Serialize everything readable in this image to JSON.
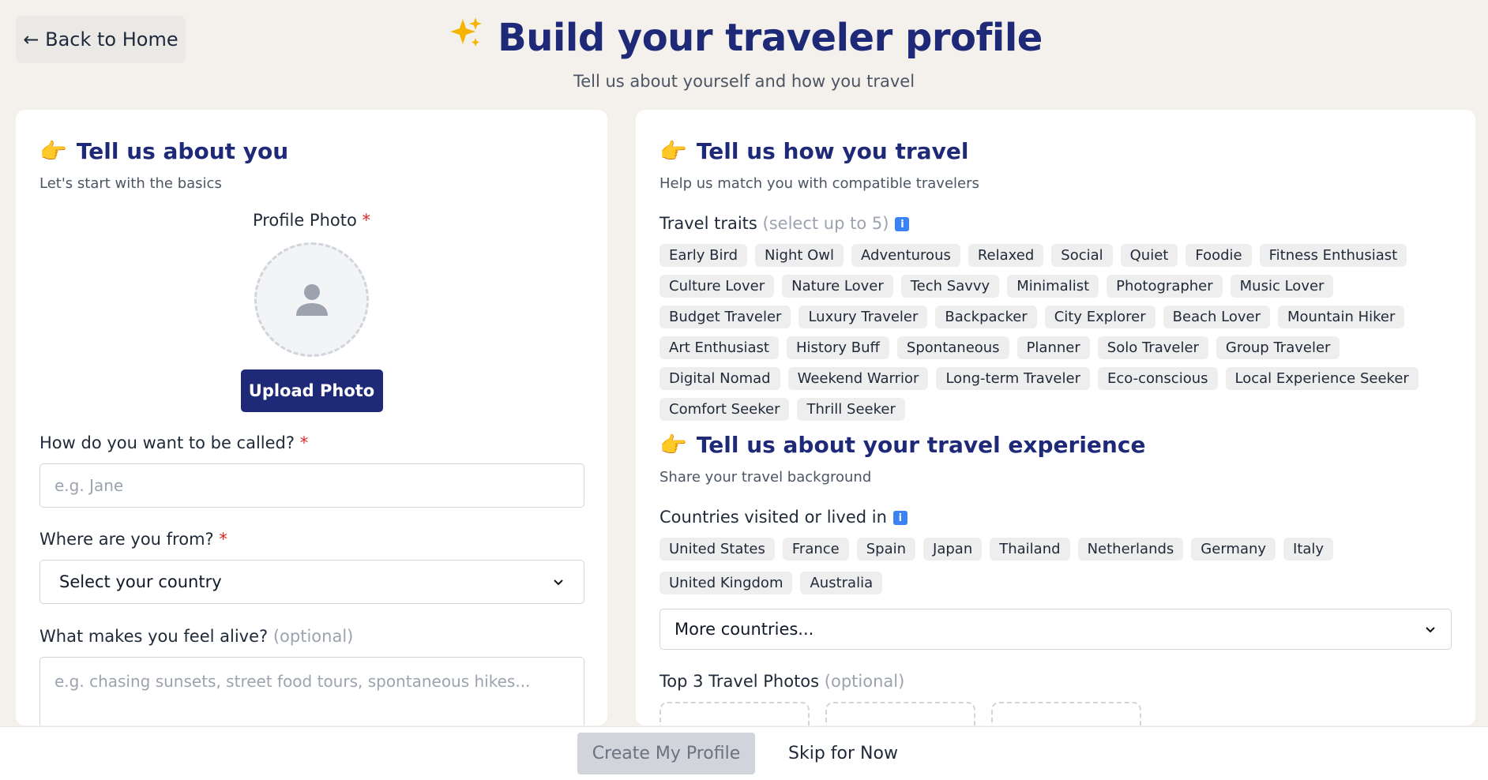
{
  "nav": {
    "back_label": "← Back to Home"
  },
  "header": {
    "title_icon": "sparkles-icon",
    "title": "Build your traveler profile",
    "subtitle": "Tell us about yourself and how you travel"
  },
  "about_you": {
    "title": "Tell us about you",
    "subtitle": "Let's start with the basics",
    "photo_label": "Profile Photo",
    "required_mark": "*",
    "upload_label": "Upload Photo",
    "name_label": "How do you want to be called?",
    "name_placeholder": "e.g. Jane",
    "country_label": "Where are you from?",
    "country_value": "Select your country",
    "alive_label": "What makes you feel alive?",
    "alive_optional": "(optional)",
    "alive_placeholder": "e.g. chasing sunsets, street food tours, spontaneous hikes..."
  },
  "how_you_travel": {
    "title": "Tell us how you travel",
    "subtitle": "Help us match you with compatible travelers",
    "traits_label": "Travel traits",
    "traits_hint": "(select up to 5)",
    "traits": [
      "Early Bird",
      "Night Owl",
      "Adventurous",
      "Relaxed",
      "Social",
      "Quiet",
      "Foodie",
      "Fitness Enthusiast",
      "Culture Lover",
      "Nature Lover",
      "Tech Savvy",
      "Minimalist",
      "Photographer",
      "Music Lover",
      "Budget Traveler",
      "Luxury Traveler",
      "Backpacker",
      "City Explorer",
      "Beach Lover",
      "Mountain Hiker",
      "Art Enthusiast",
      "History Buff",
      "Spontaneous",
      "Planner",
      "Solo Traveler",
      "Group Traveler",
      "Digital Nomad",
      "Weekend Warrior",
      "Long-term Traveler",
      "Eco-conscious",
      "Local Experience Seeker",
      "Comfort Seeker",
      "Thrill Seeker"
    ]
  },
  "experience": {
    "title": "Tell us about your travel experience",
    "subtitle": "Share your travel background",
    "countries_label": "Countries visited or lived in",
    "countries": [
      "United States",
      "France",
      "Spain",
      "Japan",
      "Thailand",
      "Netherlands",
      "Germany",
      "Italy",
      "United Kingdom",
      "Australia"
    ],
    "more_countries": "More countries...",
    "photos_label": "Top 3 Travel Photos",
    "photos_optional": "(optional)"
  },
  "footer": {
    "create_label": "Create My Profile",
    "skip_label": "Skip for Now"
  },
  "colors": {
    "primary": "#1e2a78",
    "required": "#dc2626",
    "background": "#f4f1ec"
  }
}
